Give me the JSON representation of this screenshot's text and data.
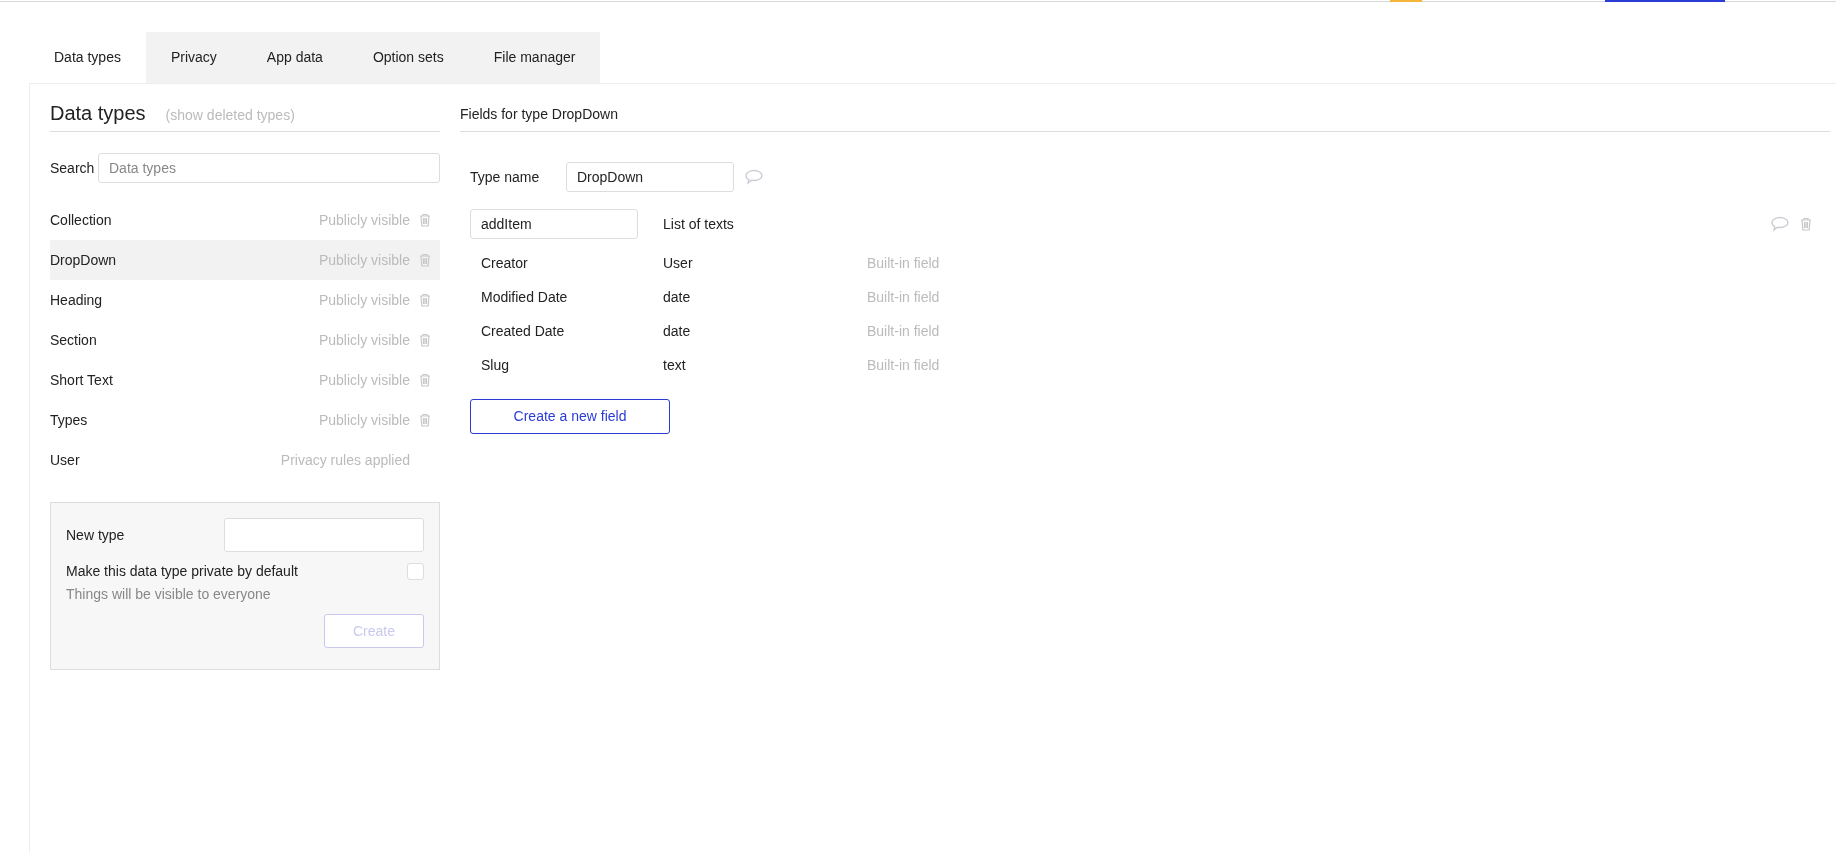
{
  "tabs": [
    {
      "label": "Data types",
      "selected": true
    },
    {
      "label": "Privacy",
      "selected": false
    },
    {
      "label": "App data",
      "selected": false
    },
    {
      "label": "Option sets",
      "selected": false
    },
    {
      "label": "File manager",
      "selected": false
    }
  ],
  "left": {
    "title": "Data types",
    "show_deleted": "(show deleted types)",
    "search_label": "Search",
    "search": {
      "placeholder": "Data types"
    },
    "types": [
      {
        "name": "Collection",
        "privacy": "Publicly visible",
        "deletable": true,
        "selected": false
      },
      {
        "name": "DropDown",
        "privacy": "Publicly visible",
        "deletable": true,
        "selected": true
      },
      {
        "name": "Heading",
        "privacy": "Publicly visible",
        "deletable": true,
        "selected": false
      },
      {
        "name": "Section",
        "privacy": "Publicly visible",
        "deletable": true,
        "selected": false
      },
      {
        "name": "Short Text",
        "privacy": "Publicly visible",
        "deletable": true,
        "selected": false
      },
      {
        "name": "Types",
        "privacy": "Publicly visible",
        "deletable": true,
        "selected": false
      },
      {
        "name": "User",
        "privacy": "Privacy rules applied",
        "deletable": false,
        "selected": false
      }
    ],
    "new_type": {
      "label": "New type",
      "private_label": "Make this data type private by default",
      "private_checked": false,
      "hint": "Things will be visible to everyone",
      "create": "Create",
      "create_disabled": true
    }
  },
  "right": {
    "title": "Fields for type DropDown",
    "type_name_label": "Type name",
    "type_name": "DropDown",
    "fields": [
      {
        "kind": "custom",
        "name": "addItem",
        "type": "List of texts"
      },
      {
        "kind": "builtin",
        "name": "Creator",
        "type": "User",
        "note": "Built-in field"
      },
      {
        "kind": "builtin",
        "name": "Modified Date",
        "type": "date",
        "note": "Built-in field"
      },
      {
        "kind": "builtin",
        "name": "Created Date",
        "type": "date",
        "note": "Built-in field"
      },
      {
        "kind": "builtin",
        "name": "Slug",
        "type": "text",
        "note": "Built-in field"
      }
    ],
    "new_field": "Create a new field"
  }
}
